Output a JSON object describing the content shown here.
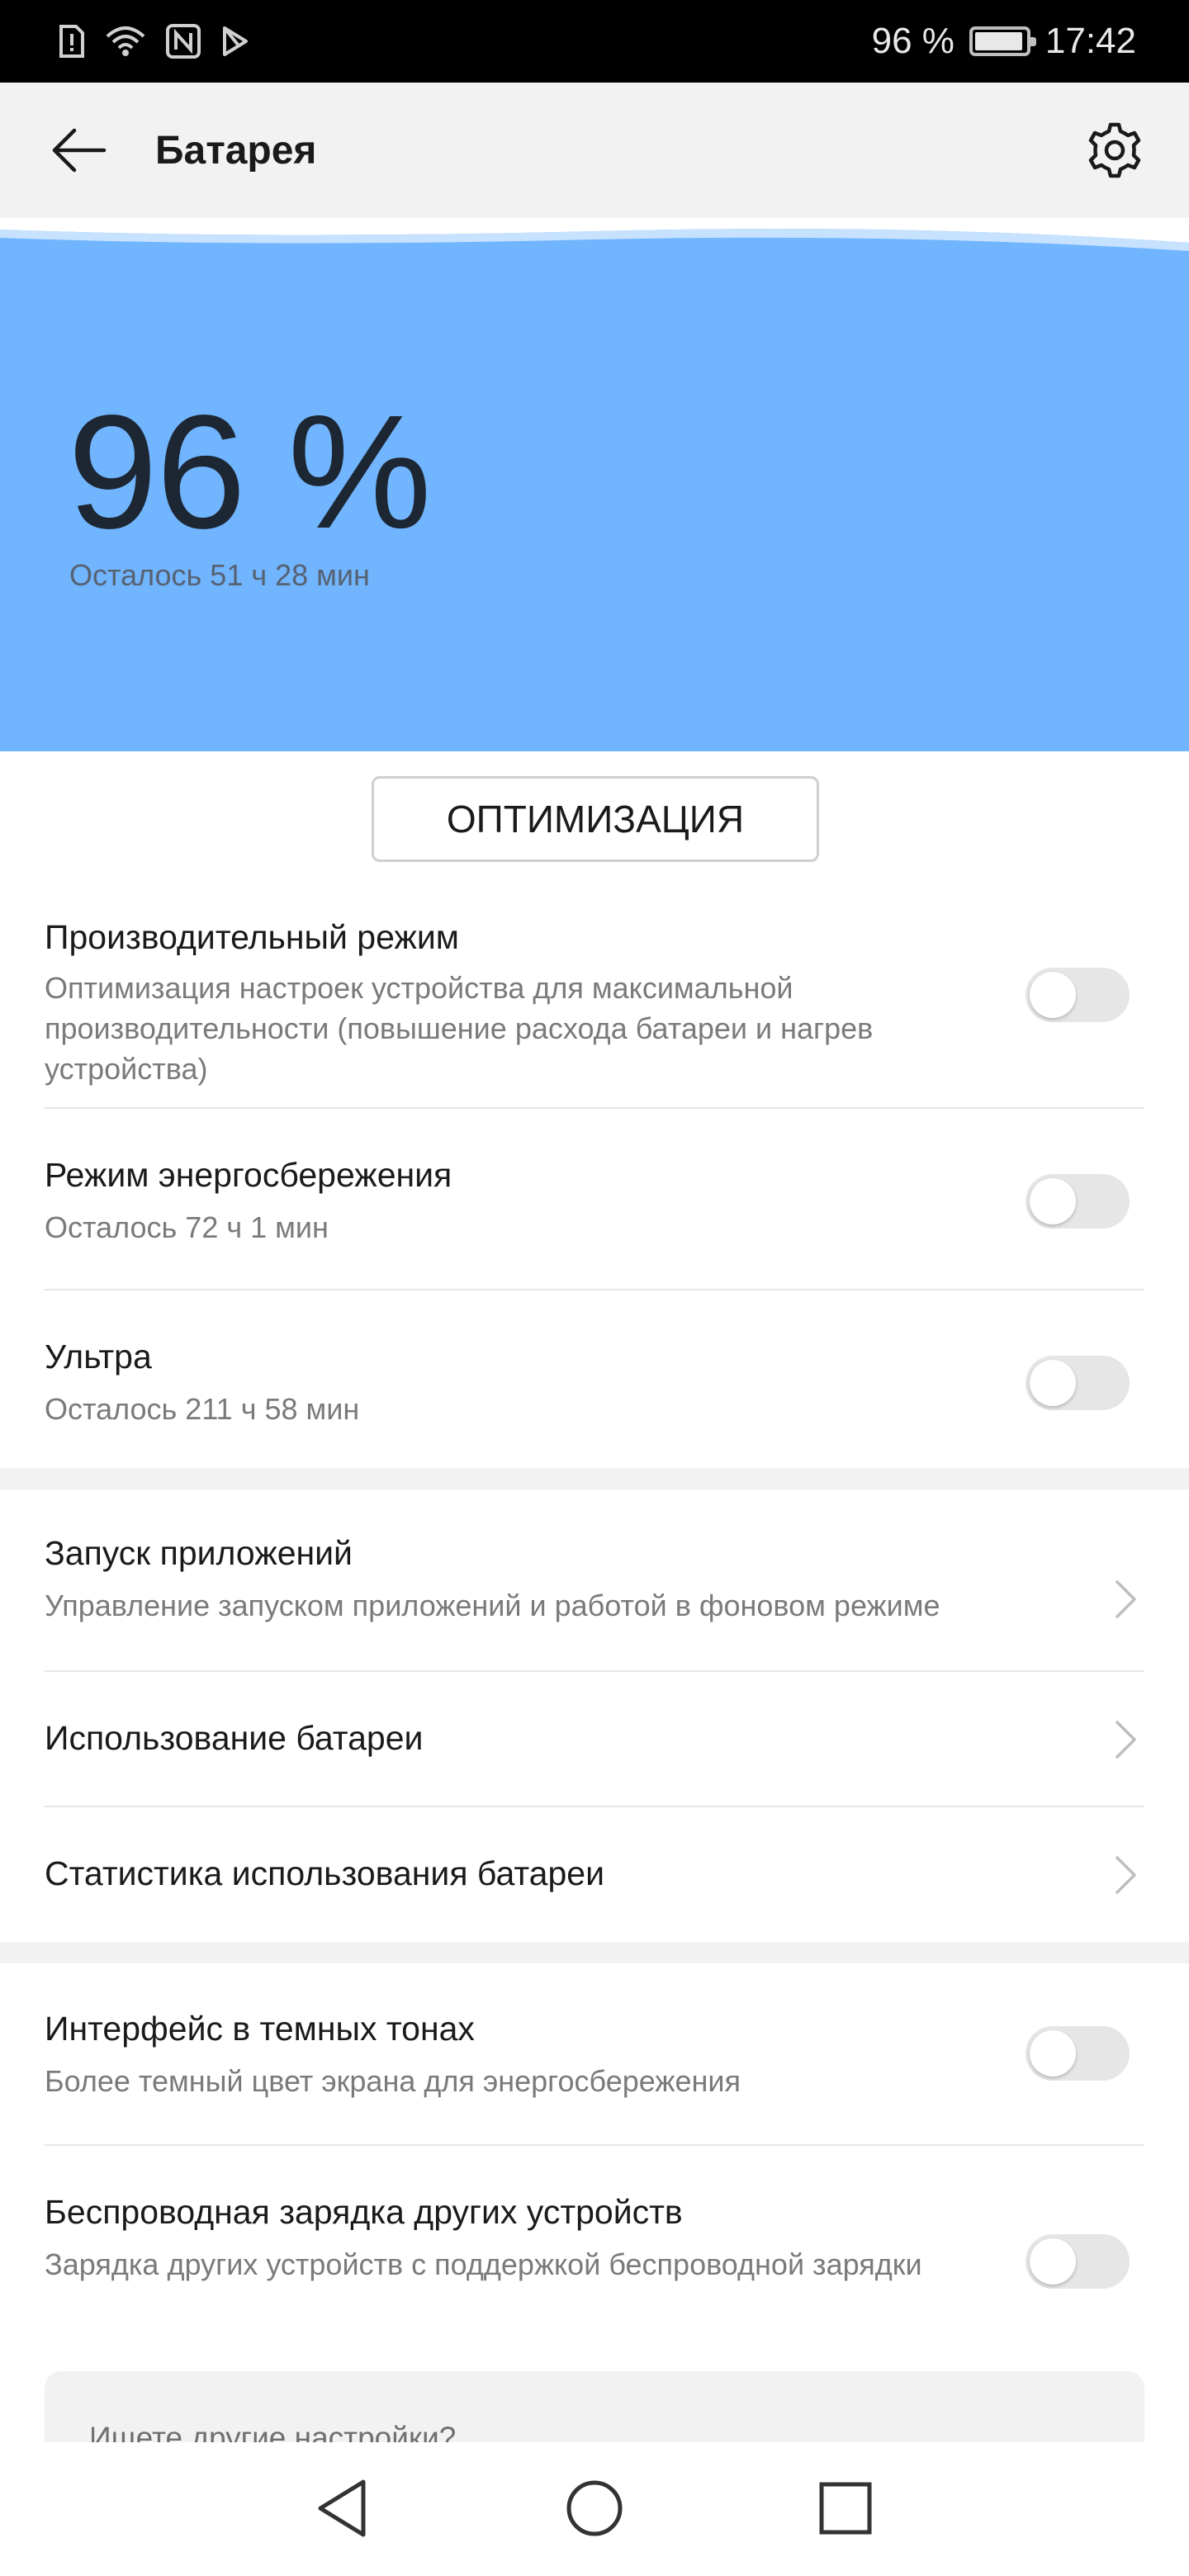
{
  "status_bar": {
    "battery_percent": "96 %",
    "battery_level": 0.96,
    "time": "17:42",
    "icons": [
      "sim-alert-icon",
      "wifi-icon",
      "nfc-icon",
      "play-store-icon"
    ]
  },
  "app_bar": {
    "title": "Батарея",
    "back_icon": "arrow-left-icon",
    "settings_icon": "gear-icon"
  },
  "hero": {
    "percent": "96 %",
    "remaining": "Осталось 51 ч 28 мин",
    "color": "#71b5fe"
  },
  "optimize_button": "ОПТИМИЗАЦИЯ",
  "modes": [
    {
      "title": "Производительный режим",
      "subtitle": "Оптимизация настроек устройства для максимальной производительности (повышение расхода батареи и нагрев устройства)",
      "enabled": false
    },
    {
      "title": "Режим энергосбережения",
      "subtitle": "Осталось 72 ч 1 мин",
      "enabled": false
    },
    {
      "title": "Ультра",
      "subtitle": "Осталось 211 ч 58 мин",
      "enabled": false
    }
  ],
  "links": [
    {
      "title": "Запуск приложений",
      "subtitle": "Управление запуском приложений и работой в фоновом режиме"
    },
    {
      "title": "Использование батареи"
    },
    {
      "title": "Статистика использования батареи"
    }
  ],
  "extras": [
    {
      "title": "Интерфейс в темных тонах",
      "subtitle": "Более темный цвет экрана для энергосбережения",
      "enabled": false
    },
    {
      "title": "Беспроводная зарядка других устройств",
      "subtitle": "Зарядка других устройств с поддержкой беспроводной зарядки",
      "enabled": false
    }
  ],
  "search_card": {
    "text": "Ищете другие настройки?"
  },
  "nav_bar": {
    "icons": [
      "back-triangle-icon",
      "home-circle-icon",
      "recents-square-icon"
    ]
  }
}
